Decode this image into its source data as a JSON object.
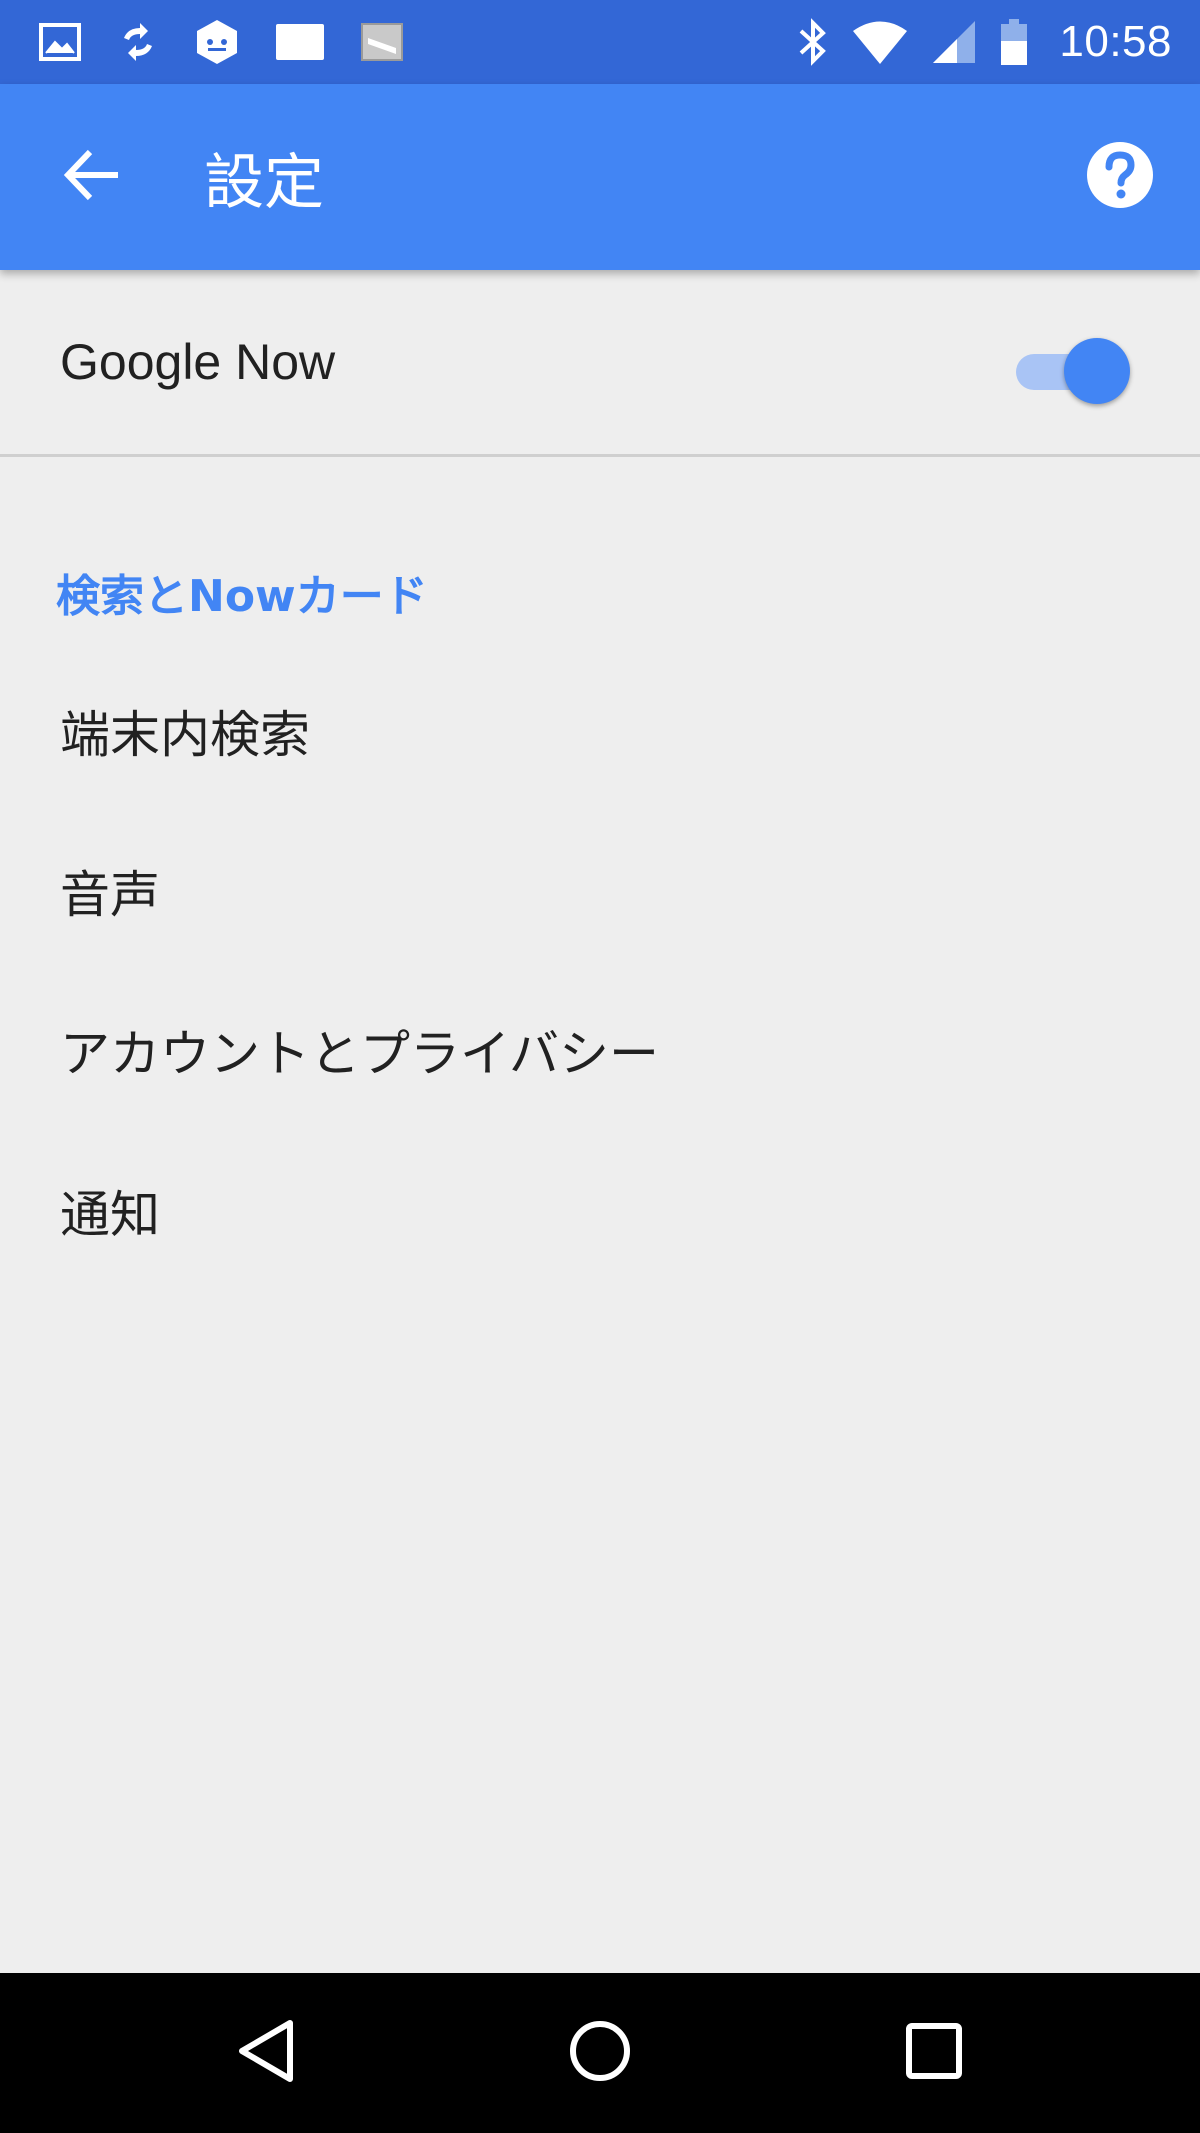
{
  "status_bar": {
    "time": "10:58",
    "notification_icons": [
      "image-icon",
      "sync-icon",
      "hexagon-app-icon",
      "message-icon",
      "photo-app-icon"
    ],
    "system_icons": [
      "bluetooth-icon",
      "wifi-icon",
      "cell-signal-icon",
      "battery-icon"
    ],
    "background_color": "#3367d6"
  },
  "app_bar": {
    "title": "設定",
    "back_icon": "arrow-back-icon",
    "help_icon": "help-icon",
    "background_color": "#4285f4"
  },
  "google_now": {
    "label": "Google Now",
    "enabled": true,
    "accent_color": "#4285f4"
  },
  "section": {
    "header": "検索とNowカード",
    "items": [
      {
        "label": "端末内検索"
      },
      {
        "label": "音声"
      },
      {
        "label": "アカウントとプライバシー"
      },
      {
        "label": "通知"
      }
    ]
  },
  "nav_bar": {
    "buttons": [
      "back-triangle-icon",
      "home-circle-icon",
      "recents-square-icon"
    ]
  }
}
